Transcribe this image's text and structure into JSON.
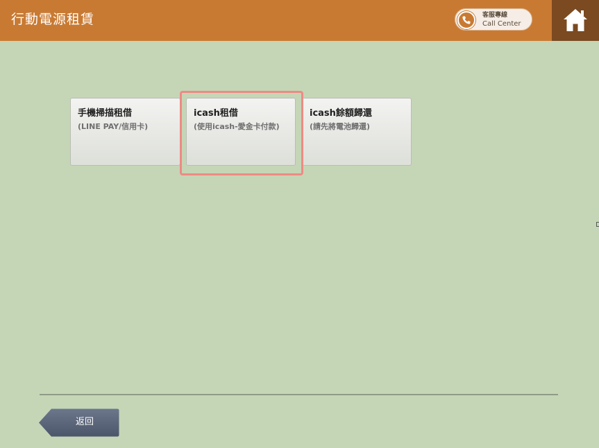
{
  "header": {
    "title": "行動電源租賃",
    "call_center": {
      "label_cn": "客服專線",
      "label_en": "Call Center",
      "icon": "phone-icon"
    },
    "home": {
      "icon": "home-icon"
    }
  },
  "options": [
    {
      "title": "手機掃描租借",
      "subtitle": "(LINE PAY/信用卡)"
    },
    {
      "title": "icash租借",
      "subtitle": "(使用icash-愛金卡付款)"
    },
    {
      "title": "icash餘額歸還",
      "subtitle": "(請先將電池歸還)"
    }
  ],
  "highlighted_option_index": 1,
  "footer": {
    "back_label": "返回"
  },
  "colors": {
    "header": "#c97a32",
    "home": "#7b4a21",
    "background": "#c5d6b7",
    "highlight": "#ee8a84",
    "back_button": "#5b667a"
  }
}
